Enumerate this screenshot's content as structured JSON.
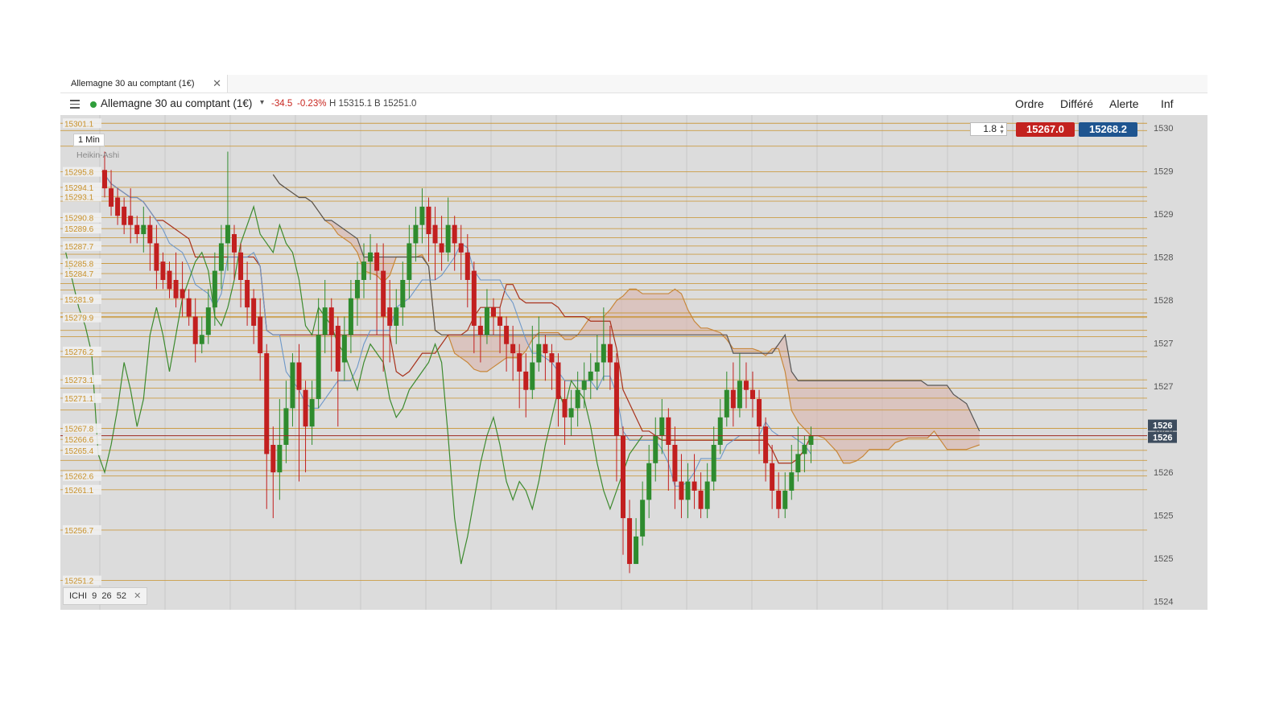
{
  "tab": {
    "label": "Allemagne 30 au comptant (1€)",
    "close_glyph": "✕"
  },
  "header": {
    "instrument": "Allemagne 30 au comptant (1€)",
    "change": "-34.5",
    "change_pct": "-0.23%",
    "high": "H 15315.1",
    "low": "B 15251.0",
    "buttons": {
      "order": "Ordre",
      "deferred": "Différé",
      "alert": "Alerte",
      "info": "Inf"
    },
    "icons": {
      "menu": "hamburger-icon",
      "status": "status-dot-icon",
      "caret": "caret-down-icon"
    },
    "caret_glyph": "▾"
  },
  "overlay": {
    "timeframe": "1 Min",
    "chart_type": "Heikin-Ashi",
    "quantity": "1.8",
    "sell_price": "15267.0",
    "buy_price": "15268.2",
    "indicator": {
      "name": "ICHI",
      "p1": "9",
      "p2": "26",
      "p3": "52"
    }
  },
  "colors": {
    "up": "#2e8b2e",
    "down": "#c21f1f",
    "level": "#c8912a",
    "tenkan": "#6d97c8",
    "kijun": "#a8321c",
    "chikou": "#3d8a2f",
    "span_a": "#c8873a",
    "span_b": "#555555",
    "cloud": "#d8b1a8",
    "bg": "#dcdcdc",
    "sell": "#c3221f",
    "buy": "#1f5590",
    "current": "#3d4c5e"
  },
  "chart_data": {
    "type": "candlestick",
    "price_axis": {
      "labels": [
        "1530",
        "1529",
        "1529",
        "1528",
        "1528",
        "1527",
        "1527",
        "1526",
        "1526",
        "1525",
        "1525",
        "1524"
      ],
      "visible_range": [
        15248,
        15302
      ]
    },
    "level_labels": [
      "15301.1",
      "15295.8",
      "15294.1",
      "15293.1",
      "15290.8",
      "15289.6",
      "15287.7",
      "15285.8",
      "15284.7",
      "15281.9",
      "15279.9",
      "15276.2",
      "15273.1",
      "15271.1",
      "15267.8",
      "15266.6",
      "15265.4",
      "15262.6",
      "15261.1",
      "15256.7",
      "15251.2"
    ],
    "levels": [
      15301.1,
      15295.8,
      15294.1,
      15293.1,
      15290.8,
      15289.6,
      15287.7,
      15285.8,
      15284.7,
      15281.9,
      15279.9,
      15276.2,
      15273.1,
      15271.1,
      15267.8,
      15266.6,
      15265.4,
      15262.6,
      15261.1,
      15256.7,
      15251.2,
      15300.3,
      15298.6,
      15292.6,
      15288.6,
      15286.8,
      15283.6,
      15282.9,
      15280.4,
      15280.0,
      15278.5,
      15277.8,
      15275.6,
      15272.2,
      15269.8,
      15264.3,
      15263.2
    ],
    "current_price": "1526",
    "current_price_2": "1526",
    "candles": [
      [
        15296,
        15294,
        15298,
        15293
      ],
      [
        15294,
        15292,
        15296,
        15291
      ],
      [
        15293,
        15291,
        15294,
        15290
      ],
      [
        15292,
        15290,
        15293,
        15289
      ],
      [
        15291,
        15290,
        15294,
        15288
      ],
      [
        15290,
        15289,
        15291,
        15288
      ],
      [
        15289,
        15290,
        15292,
        15287
      ],
      [
        15290,
        15288,
        15291,
        15285
      ],
      [
        15288,
        15285,
        15290,
        15283
      ],
      [
        15286,
        15284,
        15287,
        15283
      ],
      [
        15285,
        15283,
        15286,
        15282
      ],
      [
        15284,
        15282,
        15287,
        15281
      ],
      [
        15283,
        15282,
        15286,
        15280
      ],
      [
        15282,
        15280,
        15283,
        15279
      ],
      [
        15280,
        15277,
        15282,
        15275
      ],
      [
        15277,
        15278,
        15280,
        15276
      ],
      [
        15278,
        15281,
        15283,
        15277
      ],
      [
        15281,
        15285,
        15287,
        15279
      ],
      [
        15285,
        15288,
        15290,
        15283
      ],
      [
        15288,
        15290,
        15298,
        15285
      ],
      [
        15289,
        15287,
        15290,
        15284
      ],
      [
        15287,
        15284,
        15288,
        15281
      ],
      [
        15284,
        15281,
        15286,
        15279
      ],
      [
        15282,
        15279,
        15283,
        15277
      ],
      [
        15280,
        15276,
        15282,
        15273
      ],
      [
        15276,
        15265,
        15277,
        15259
      ],
      [
        15266,
        15263,
        15268,
        15258
      ],
      [
        15263,
        15266,
        15271,
        15260
      ],
      [
        15266,
        15270,
        15273,
        15264
      ],
      [
        15270,
        15275,
        15276,
        15268
      ],
      [
        15275,
        15272,
        15277,
        15262
      ],
      [
        15272,
        15268,
        15273,
        15263
      ],
      [
        15268,
        15271,
        15273,
        15266
      ],
      [
        15271,
        15278,
        15282,
        15270
      ],
      [
        15278,
        15281,
        15284,
        15276
      ],
      [
        15281,
        15278,
        15282,
        15274
      ],
      [
        15279,
        15274,
        15280,
        15268
      ],
      [
        15275,
        15278,
        15280,
        15273
      ],
      [
        15278,
        15282,
        15284,
        15276
      ],
      [
        15282,
        15284,
        15286,
        15279
      ],
      [
        15284,
        15286,
        15288,
        15282
      ],
      [
        15286,
        15287,
        15289,
        15284
      ],
      [
        15287,
        15285,
        15288,
        15278
      ],
      [
        15285,
        15280,
        15288,
        15274
      ],
      [
        15281,
        15279,
        15284,
        15275
      ],
      [
        15279,
        15281,
        15283,
        15277
      ],
      [
        15281,
        15284,
        15286,
        15279
      ],
      [
        15284,
        15288,
        15290,
        15282
      ],
      [
        15288,
        15290,
        15292,
        15286
      ],
      [
        15290,
        15292,
        15294,
        15288
      ],
      [
        15292,
        15289,
        15293,
        15286
      ],
      [
        15290,
        15288,
        15292,
        15284
      ],
      [
        15288,
        15287,
        15291,
        15285
      ],
      [
        15287,
        15290,
        15293,
        15286
      ],
      [
        15290,
        15288,
        15291,
        15285
      ],
      [
        15288,
        15287,
        15290,
        15284
      ],
      [
        15287,
        15284,
        15289,
        15281
      ],
      [
        15285,
        15279,
        15286,
        15276
      ],
      [
        15279,
        15278,
        15280,
        15275
      ],
      [
        15278,
        15281,
        15283,
        15277
      ],
      [
        15281,
        15280,
        15282,
        15278
      ],
      [
        15280,
        15279,
        15281,
        15276
      ],
      [
        15279,
        15277,
        15280,
        15274
      ],
      [
        15277,
        15276,
        15279,
        15273
      ],
      [
        15276,
        15274,
        15277,
        15270
      ],
      [
        15274,
        15272,
        15276,
        15269
      ],
      [
        15272,
        15275,
        15279,
        15271
      ],
      [
        15275,
        15277,
        15280,
        15274
      ],
      [
        15277,
        15276,
        15278,
        15273
      ],
      [
        15276,
        15275,
        15277,
        15272
      ],
      [
        15275,
        15271,
        15276,
        15268
      ],
      [
        15271,
        15269,
        15273,
        15266
      ],
      [
        15269,
        15270,
        15272,
        15267
      ],
      [
        15270,
        15272,
        15274,
        15268
      ],
      [
        15272,
        15273,
        15275,
        15270
      ],
      [
        15273,
        15274,
        15276,
        15271
      ],
      [
        15274,
        15275,
        15278,
        15272
      ],
      [
        15275,
        15277,
        15281,
        15273
      ],
      [
        15277,
        15275,
        15279,
        15272
      ],
      [
        15275,
        15267,
        15276,
        15262
      ],
      [
        15267,
        15258,
        15268,
        15254
      ],
      [
        15258,
        15253,
        15260,
        15252
      ],
      [
        15253,
        15256,
        15258,
        15253
      ],
      [
        15256,
        15260,
        15262,
        15255
      ],
      [
        15260,
        15264,
        15266,
        15258
      ],
      [
        15264,
        15267,
        15269,
        15262
      ],
      [
        15267,
        15269,
        15271,
        15265
      ],
      [
        15269,
        15266,
        15270,
        15261
      ],
      [
        15266,
        15262,
        15268,
        15259
      ],
      [
        15262,
        15260,
        15265,
        15258
      ],
      [
        15260,
        15262,
        15264,
        15258
      ],
      [
        15262,
        15261,
        15265,
        15259
      ],
      [
        15261,
        15259,
        15263,
        15258
      ],
      [
        15259,
        15262,
        15264,
        15258
      ],
      [
        15262,
        15266,
        15268,
        15261
      ],
      [
        15266,
        15269,
        15271,
        15265
      ],
      [
        15269,
        15272,
        15274,
        15268
      ],
      [
        15272,
        15270,
        15275,
        15268
      ],
      [
        15270,
        15273,
        15276,
        15269
      ],
      [
        15273,
        15272,
        15275,
        15270
      ],
      [
        15272,
        15271,
        15274,
        15269
      ],
      [
        15271,
        15268,
        15272,
        15265
      ],
      [
        15268,
        15264,
        15269,
        15262
      ],
      [
        15264,
        15261,
        15266,
        15259
      ],
      [
        15261,
        15259,
        15263,
        15258
      ],
      [
        15259,
        15261,
        15263,
        15258
      ],
      [
        15261,
        15263,
        15266,
        15260
      ],
      [
        15263,
        15265,
        15268,
        15262
      ],
      [
        15265,
        15266,
        15267,
        15263
      ],
      [
        15266,
        15267,
        15268,
        15264
      ]
    ]
  }
}
